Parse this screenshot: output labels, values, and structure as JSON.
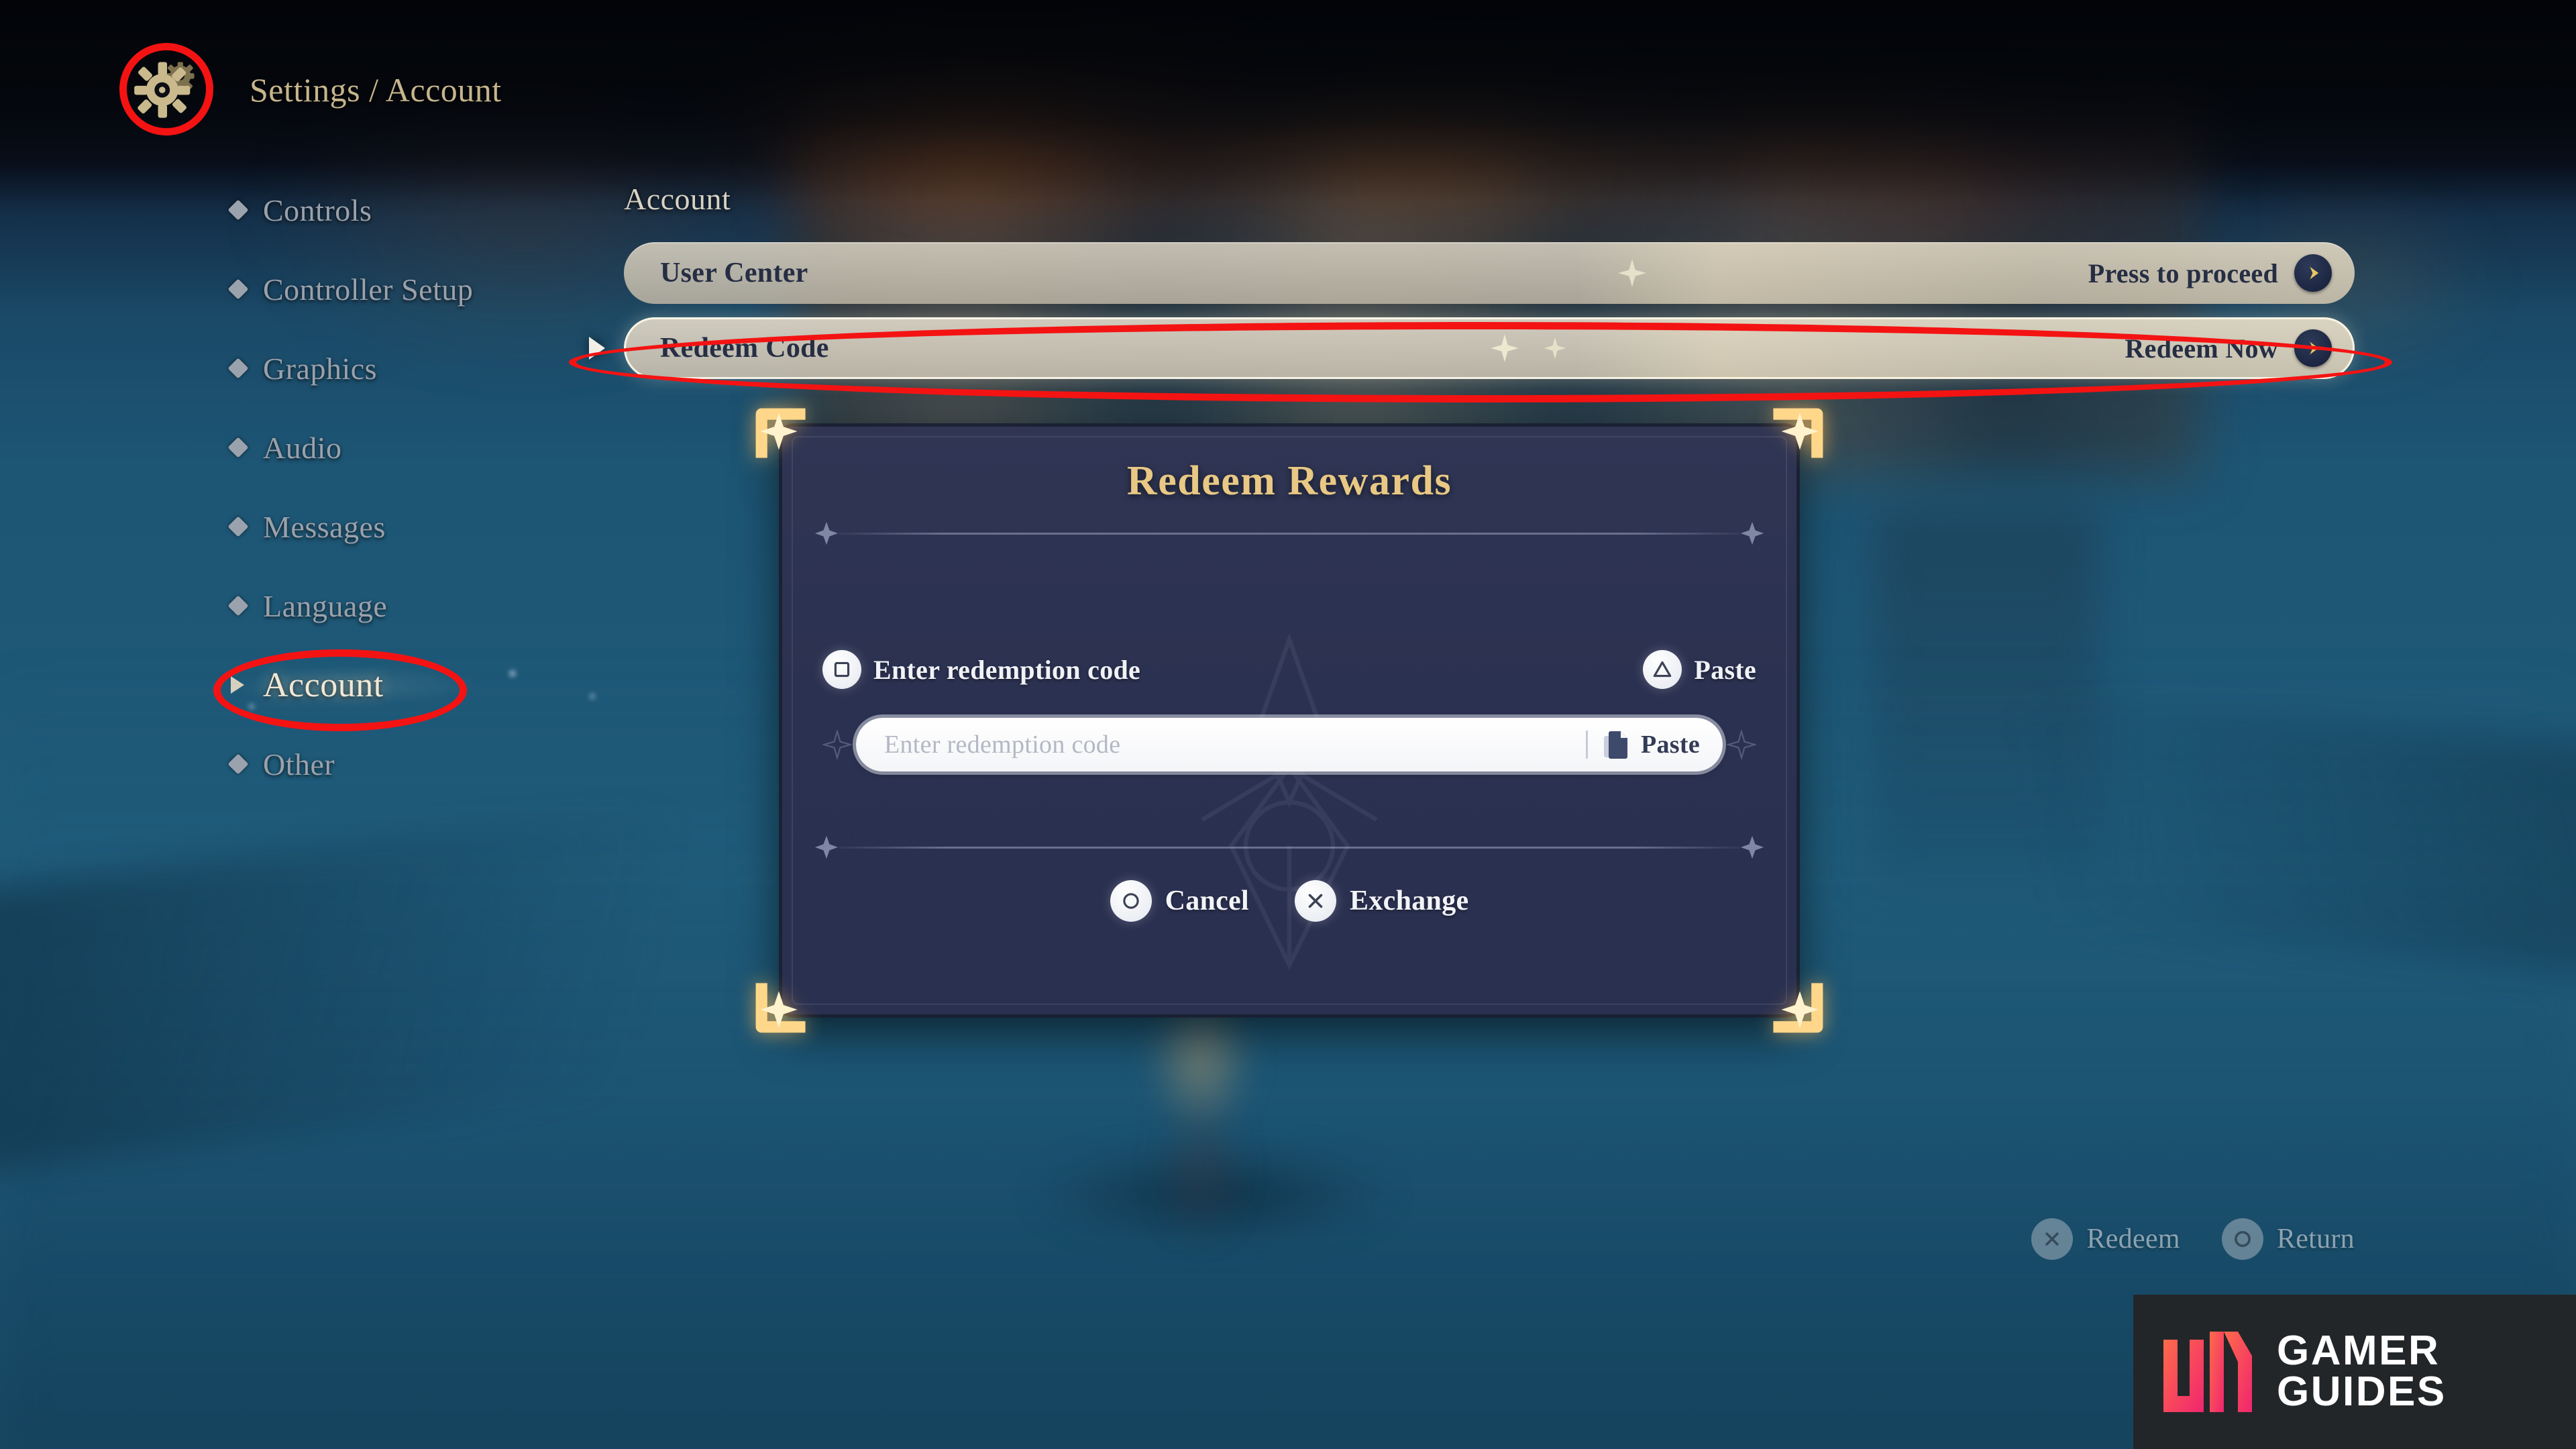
{
  "header": {
    "gear_icon": "gear-icon",
    "breadcrumb": "Settings / Account",
    "breadcrumb_parts": [
      "Settings",
      "/",
      "Account"
    ]
  },
  "sidebar": {
    "items": [
      {
        "label": "Controls",
        "active": false
      },
      {
        "label": "Controller Setup",
        "active": false
      },
      {
        "label": "Graphics",
        "active": false
      },
      {
        "label": "Audio",
        "active": false
      },
      {
        "label": "Messages",
        "active": false
      },
      {
        "label": "Language",
        "active": false
      },
      {
        "label": "Account",
        "active": true
      },
      {
        "label": "Other",
        "active": false
      }
    ]
  },
  "main": {
    "title": "Account",
    "rows": [
      {
        "label": "User Center",
        "value": "Press to proceed",
        "selected": false,
        "arrow_icon": "chevron-right-icon"
      },
      {
        "label": "Redeem Code",
        "value": "Redeem Now",
        "selected": true,
        "arrow_icon": "chevron-right-icon"
      }
    ]
  },
  "modal": {
    "title": "Redeem Rewards",
    "hints": [
      {
        "button": "square-button-icon",
        "label": "Enter redemption code"
      },
      {
        "button": "triangle-button-icon",
        "label": "Paste"
      }
    ],
    "input": {
      "placeholder": "Enter redemption code",
      "value": "",
      "paste_label": "Paste",
      "paste_icon": "copy-paste-icon"
    },
    "actions": [
      {
        "button": "circle-button-icon",
        "label": "Cancel"
      },
      {
        "button": "cross-button-icon",
        "label": "Exchange"
      }
    ]
  },
  "footer": {
    "hints": [
      {
        "button": "cross-button-icon",
        "label": "Redeem"
      },
      {
        "button": "circle-button-icon",
        "label": "Return"
      }
    ]
  },
  "watermark": {
    "line1": "GAMER",
    "line2": "GUIDES",
    "mark": "gamer-guides-logo-icon"
  },
  "annotations": {
    "color": "#f41313",
    "shapes": [
      {
        "name": "gear-highlight",
        "target": "gear-icon"
      },
      {
        "name": "account-highlight",
        "target": "sidebar-item-account"
      },
      {
        "name": "redeem-code-highlight",
        "target": "option-row-redeem-code"
      }
    ]
  },
  "colors": {
    "gold": "#e8c884",
    "breadcrumb": "#c6b58c",
    "modal_bg": "#2b3150",
    "row_bg": "#cec8ba",
    "row_text": "#262e44",
    "background": "#1d5574",
    "annotation_red": "#f41313"
  }
}
